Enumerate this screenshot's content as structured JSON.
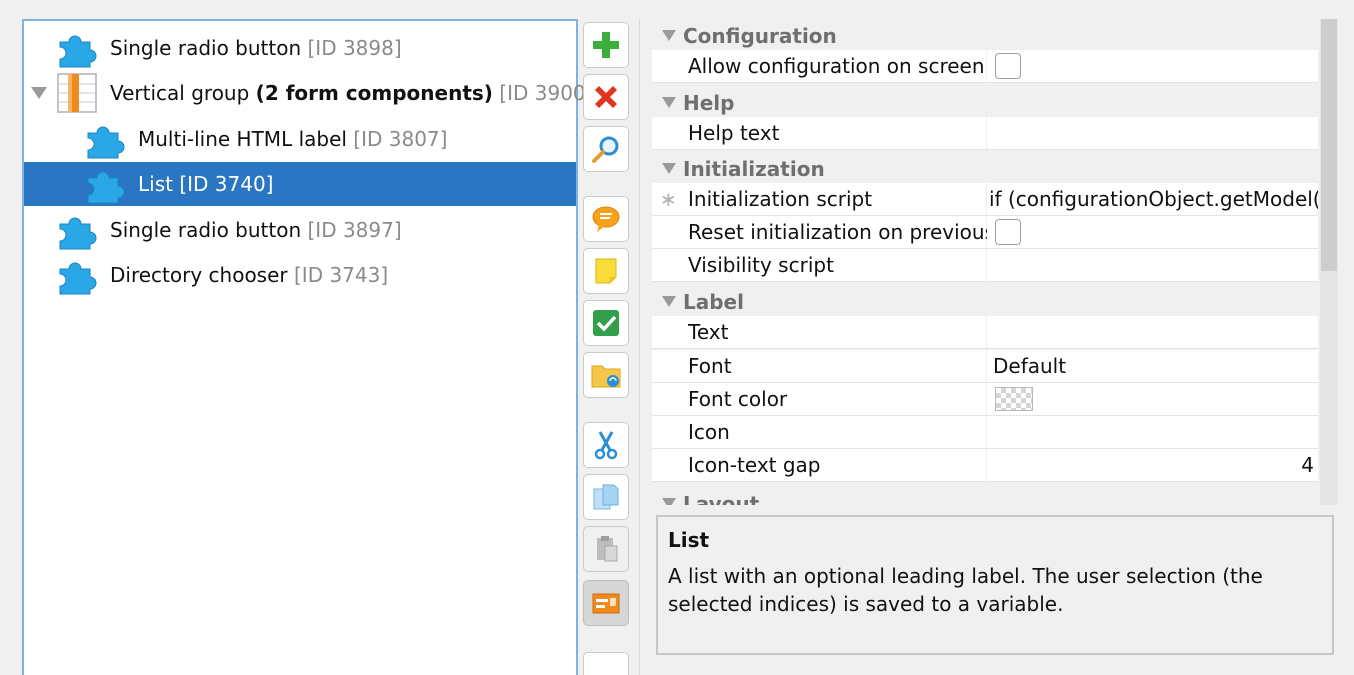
{
  "tree": {
    "items": [
      {
        "name": "Single radio button",
        "bold": "",
        "id_label": "[ID 3898]"
      },
      {
        "name": "Vertical group",
        "bold": "(2 form components)",
        "id_label": "[ID 3900]"
      },
      {
        "name": "Multi-line HTML label",
        "bold": "",
        "id_label": "[ID 3807]"
      },
      {
        "name": "List",
        "bold": "",
        "id_label": "[ID 3740]"
      },
      {
        "name": "Single radio button",
        "bold": "",
        "id_label": "[ID 3897]"
      },
      {
        "name": "Directory chooser",
        "bold": "",
        "id_label": "[ID 3743]"
      }
    ],
    "selected_index": 3
  },
  "toolbar": {
    "buttons": [
      {
        "icon": "plus-icon"
      },
      {
        "icon": "delete-icon"
      },
      {
        "icon": "magnifier-icon"
      },
      {
        "icon": "comment-icon"
      },
      {
        "icon": "sticky-note-icon"
      },
      {
        "icon": "checkmark-icon"
      },
      {
        "icon": "folder-sync-icon"
      },
      {
        "icon": "scissors-icon"
      },
      {
        "icon": "copy-icon"
      },
      {
        "icon": "paste-icon"
      },
      {
        "icon": "component-card-icon"
      }
    ]
  },
  "properties": {
    "sections": [
      {
        "title": "Configuration",
        "rows": [
          {
            "name": "Allow configuration on screen",
            "type": "checkbox",
            "checked": false
          }
        ]
      },
      {
        "title": "Help",
        "rows": [
          {
            "name": "Help text",
            "type": "text",
            "value": ""
          }
        ]
      },
      {
        "title": "Initialization",
        "rows": [
          {
            "name": "Initialization script",
            "type": "text",
            "value": "if (configurationObject.getModel().g",
            "modified": true
          },
          {
            "name": "Reset initialization on previous",
            "type": "checkbox",
            "checked": false
          },
          {
            "name": "Visibility script",
            "type": "text",
            "value": ""
          }
        ]
      },
      {
        "title": "Label",
        "rows": [
          {
            "name": "Text",
            "type": "text",
            "value": ""
          },
          {
            "name": "Font",
            "type": "text",
            "value": "Default"
          },
          {
            "name": "Font color",
            "type": "color",
            "value": ""
          },
          {
            "name": "Icon",
            "type": "text",
            "value": ""
          },
          {
            "name": "Icon-text gap",
            "type": "number",
            "value": "4"
          }
        ]
      },
      {
        "title": "Layout",
        "rows": []
      }
    ]
  },
  "description": {
    "title": "List",
    "text": "A list with an optional leading label. The user selection (the selected indices) is saved to a variable."
  },
  "colors": {
    "selection": "#2a76c2",
    "tree_border": "#7fb1e3",
    "puzzle_icon": "#2aa7e6",
    "section_text": "#6f6f6f"
  }
}
